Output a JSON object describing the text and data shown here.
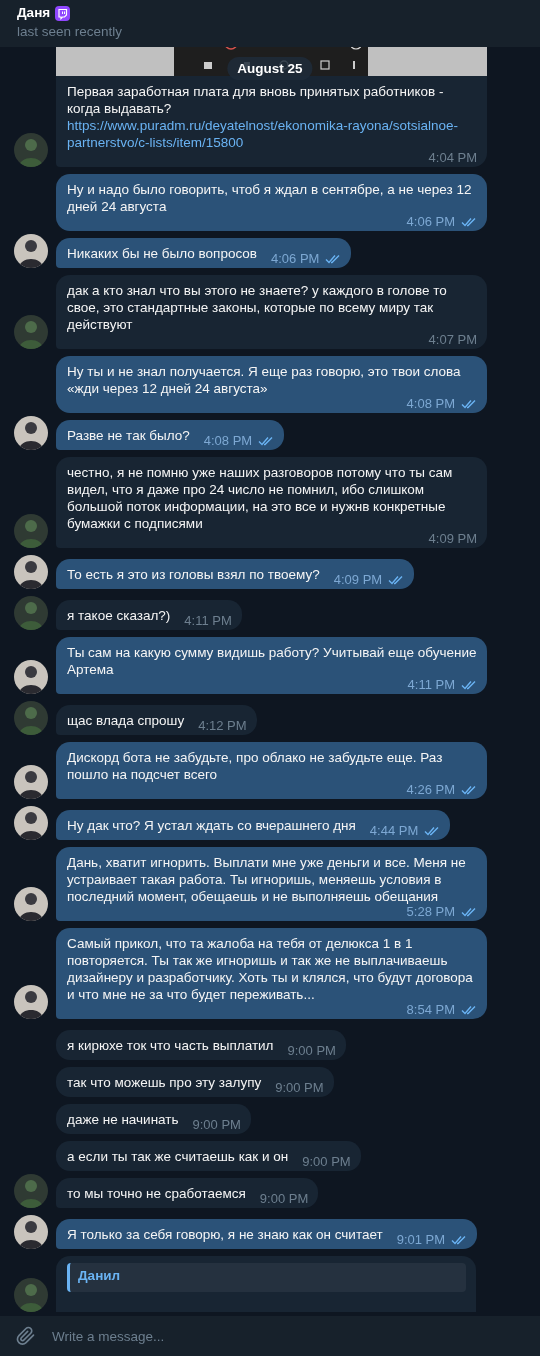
{
  "header": {
    "name": "Даня",
    "status": "last seen recently"
  },
  "date_pill": "August 25",
  "messages": [
    {
      "kind": "in",
      "text": "Первая заработная плата для вновь принятых работников - когда выдавать?",
      "link": "https://www.puradm.ru/deyatelnost/ekonomika-rayona/sotsialnoe-partnerstvo/c-lists/item/15800",
      "time": "4:04 PM",
      "avatar": true
    },
    {
      "kind": "out",
      "text": "Ну и надо было говорить, чтоб я ждал в сентябре, а не через 12 дней 24 августа",
      "time": "4:06 PM",
      "read": true,
      "avatar": false
    },
    {
      "kind": "out",
      "text": "Никаких бы не было вопросов",
      "time": "4:06 PM",
      "read": true,
      "avatar": true
    },
    {
      "kind": "in",
      "text": "дак а кто знал что вы этого не знаете? у каждого в голове то свое, это стандартные законы, которые по всему миру так действуют",
      "time": "4:07 PM",
      "avatar": true
    },
    {
      "kind": "out",
      "text": "Ну ты и не знал получается. Я еще раз говорю, это твои слова «жди через 12 дней 24 августа»",
      "time": "4:08 PM",
      "read": true,
      "avatar": false
    },
    {
      "kind": "out",
      "text": "Разве не так было?",
      "time": "4:08 PM",
      "read": true,
      "avatar": true
    },
    {
      "kind": "in",
      "text": "честно, я не помню уже наших разговоров потому что ты сам видел, что я даже про 24 число не помнил, ибо слишком большой поток информации, на это все и нужнв конкретные бумажки с подписями",
      "time": "4:09 PM",
      "avatar": true
    },
    {
      "kind": "out",
      "text": "То есть я это из головы взял по твоему?",
      "time": "4:09 PM",
      "read": true,
      "avatar": true
    },
    {
      "kind": "in",
      "text": "я такое сказал?)",
      "time": "4:11 PM",
      "avatar": true
    },
    {
      "kind": "out",
      "text": "Ты сам на какую сумму видишь работу? Учитывай еще обучение Артема",
      "time": "4:11 PM",
      "read": true,
      "avatar": true
    },
    {
      "kind": "in",
      "text": "щас влада спрошу",
      "time": "4:12 PM",
      "avatar": true
    },
    {
      "kind": "out",
      "text": "Дискорд бота не забудьте, про облако не забудьте еще. Раз пошло на подсчет всего",
      "time": "4:26 PM",
      "read": true,
      "avatar": true
    },
    {
      "kind": "out",
      "text": "Ну дак что? Я устал ждать со вчерашнего дня",
      "time": "4:44 PM",
      "read": true,
      "avatar": true
    },
    {
      "kind": "out",
      "text": "Дань, хватит игнорить. Выплати мне уже деньги и все. Меня не устраивает такая работа. Ты игноришь, меняешь условия в последний момент, обещаешь и не выполняешь обещания",
      "time": "5:28 PM",
      "read": true,
      "avatar": true
    },
    {
      "kind": "out",
      "text": "Самый прикол, что та жалоба на тебя от делюкса 1 в 1 повторяется. Ты так же игноришь и так же не выплачиваешь дизайнеру и разработчику. Хоть ты и клялся, что будут договора и что мне не за что будет переживать...",
      "time": "8:54 PM",
      "read": true,
      "avatar": true
    },
    {
      "kind": "in",
      "text": "я кирюхе ток что часть выплатил",
      "time": "9:00 PM",
      "avatar": false
    },
    {
      "kind": "in",
      "text": "так что можешь про эту залупу",
      "time": "9:00 PM",
      "avatar": false
    },
    {
      "kind": "in",
      "text": "даже не начинать",
      "time": "9:00 PM",
      "avatar": false
    },
    {
      "kind": "in",
      "text": "а если ты так же считаешь как и он",
      "time": "9:00 PM",
      "avatar": false
    },
    {
      "kind": "in",
      "text": "то мы точно не сработаемся",
      "time": "9:00 PM",
      "avatar": true
    },
    {
      "kind": "out",
      "text": "Я только за себя говорю, я не знаю как он считает",
      "time": "9:01 PM",
      "read": true,
      "avatar": true
    },
    {
      "kind": "in",
      "reply_name": "Данил",
      "avatar": true
    }
  ],
  "composer": {
    "placeholder": "Write a message..."
  }
}
